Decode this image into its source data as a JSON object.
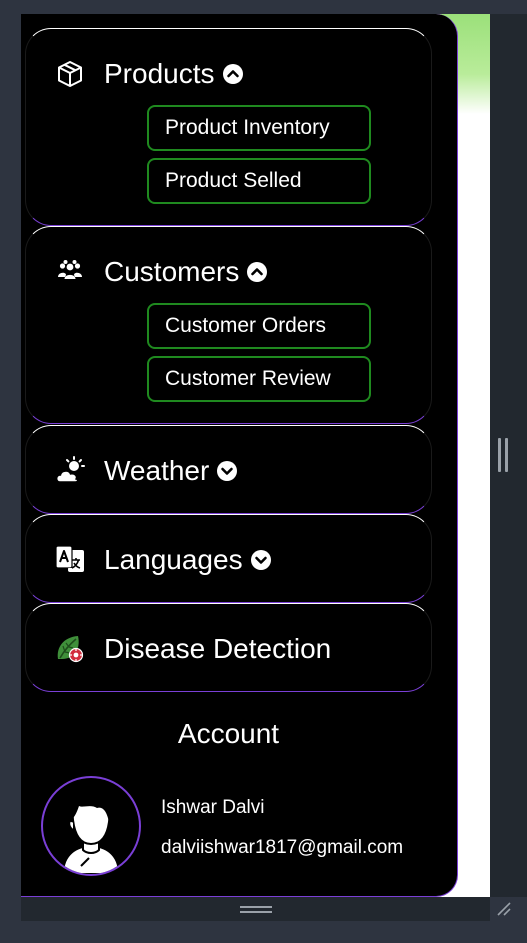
{
  "sidebar": {
    "sections": [
      {
        "title": "Products",
        "icon": "cube-icon",
        "expanded": true,
        "items": [
          "Product Inventory",
          "Product Selled"
        ]
      },
      {
        "title": "Customers",
        "icon": "users-icon",
        "expanded": true,
        "items": [
          "Customer Orders",
          "Customer Review"
        ]
      },
      {
        "title": "Weather",
        "icon": "cloud-sun-icon",
        "expanded": false
      },
      {
        "title": "Languages",
        "icon": "translate-icon",
        "expanded": false
      },
      {
        "title": "Disease Detection",
        "icon": "leaf-virus-icon"
      }
    ]
  },
  "account": {
    "title": "Account",
    "name": "Ishwar Dalvi",
    "email": "dalviishwar1817@gmail.com",
    "avatar_icon": "user-avatar-icon"
  },
  "colors": {
    "sidebar_bg": "#000000",
    "accent_purple": "#7a3fd6",
    "button_border_green": "#1f8a1f",
    "text": "#ffffff"
  }
}
